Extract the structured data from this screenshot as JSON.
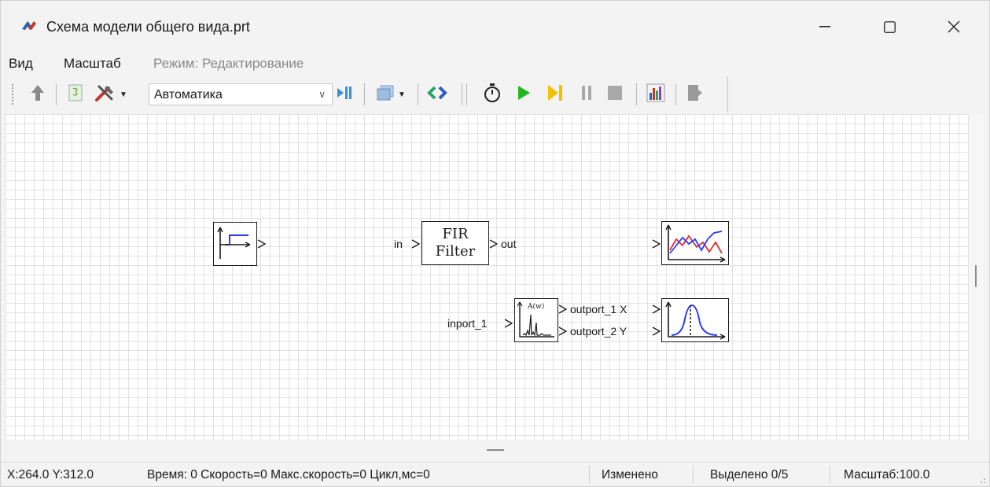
{
  "window": {
    "title": "Схема модели общего вида.prt",
    "app_icon": "engee-logo-icon"
  },
  "menu": {
    "view": "Вид",
    "scale": "Масштаб",
    "mode": "Режим: Редактирование"
  },
  "toolbar": {
    "library_selector_value": "Автоматика",
    "icons": [
      "up-arrow-icon",
      "script-icon",
      "tools-icon",
      "library-dropdown",
      "step-into-icon",
      "layers-icon",
      "connect-icon",
      "stopwatch-icon",
      "play-icon",
      "step-icon",
      "pause-icon",
      "stop-icon",
      "chart-icon",
      "exit-icon"
    ]
  },
  "diagram": {
    "blocks": [
      {
        "name": "step-source-block",
        "icon": "step-signal-icon"
      },
      {
        "name": "fir-filter-block",
        "line1": "FIR",
        "line2": "Filter",
        "in_port": "in",
        "out_port": "out"
      },
      {
        "name": "scope-block",
        "icon": "scope-plot-icon"
      },
      {
        "name": "spectrum-block",
        "icon_label": "A(w)",
        "in_port": "inport_1",
        "out_port_1": "outport_1 X",
        "out_port_2": "outport_2 Y"
      },
      {
        "name": "xy-plot-block",
        "icon": "bell-curve-plot-icon"
      }
    ]
  },
  "status": {
    "coords": "X:264.0  Y:312.0",
    "sim_info": "Время: 0 Скорость=0 Макс.скорость=0 Цикл,мс=0",
    "modified": "Изменено",
    "selected": "Выделено 0/5",
    "zoom": "Масштаб:100.0"
  },
  "colors": {
    "play_green": "#1fb81f",
    "step_yellow": "#f2c200",
    "plot_blue": "#2b3cff",
    "plot_red": "#e03030"
  }
}
